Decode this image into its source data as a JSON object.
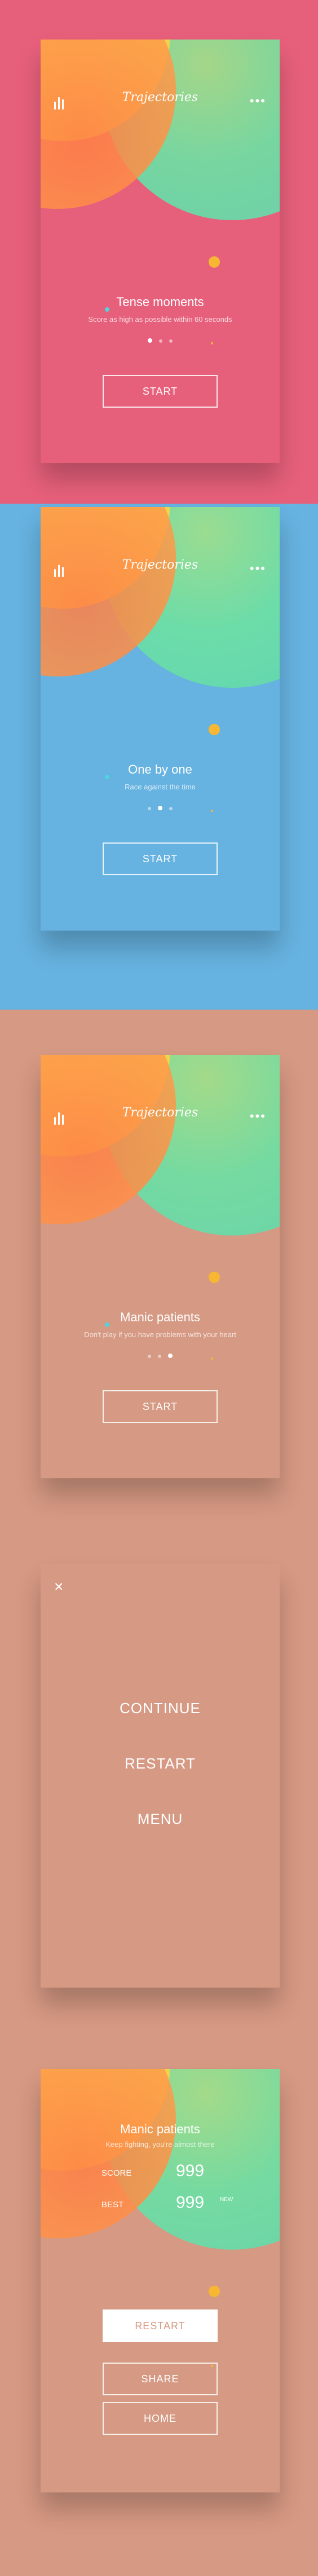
{
  "app": {
    "logo": "Trajectories"
  },
  "icons": {
    "stats": "bar-chart-icon",
    "menu": "more-dots-icon",
    "close": "close-icon"
  },
  "colors": {
    "pink": "#e7607b",
    "blue": "#66b2e0",
    "salmon": "#d69983",
    "ball": "#f7b733",
    "cyan": "#4fd4df"
  },
  "screens": [
    {
      "title": "Tense moments",
      "subtitle": "Score as high as possible within 60 seconds",
      "button": "START",
      "active_page": 1
    },
    {
      "title": "One by one",
      "subtitle": "Race against the time",
      "button": "START",
      "active_page": 2
    },
    {
      "title": "Manic patients",
      "subtitle": "Don't play if you have problems with your heart",
      "button": "START",
      "active_page": 3
    }
  ],
  "pause_menu": {
    "close": "×",
    "items": [
      "CONTINUE",
      "RESTART",
      "MENU"
    ]
  },
  "results": {
    "title": "Manic patients",
    "subtitle": "Keep fighting, you're almost there",
    "score_label": "SCORE",
    "score_value": "999",
    "best_label": "BEST",
    "best_value": "999",
    "new_badge": "NEW",
    "buttons": [
      "RESTART",
      "SHARE",
      "HOME"
    ]
  }
}
